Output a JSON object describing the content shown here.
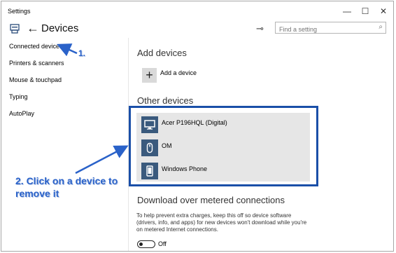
{
  "window": {
    "title": "Settings",
    "minimize": "—",
    "maximize": "☐",
    "close": "✕"
  },
  "header": {
    "back_glyph": "←",
    "title": "Devices",
    "pin_glyph": "⊸",
    "search_placeholder": "Find a setting",
    "search_glyph": "⌕"
  },
  "sidebar": {
    "items": [
      {
        "label": "Connected devices",
        "selected": true
      },
      {
        "label": "Printers & scanners"
      },
      {
        "label": "Mouse & touchpad"
      },
      {
        "label": "Typing"
      },
      {
        "label": "AutoPlay"
      }
    ]
  },
  "content": {
    "add_heading": "Add devices",
    "add_button_glyph": "+",
    "add_label": "Add a device",
    "other_heading": "Other devices",
    "devices": [
      {
        "name": "Acer P196HQL (Digital)",
        "icon": "monitor-icon"
      },
      {
        "name": "OM",
        "icon": "mouse-icon"
      },
      {
        "name": "Windows Phone",
        "icon": "phone-icon"
      }
    ],
    "metered_heading": "Download over metered connections",
    "metered_desc": "To help prevent extra charges, keep this off so device software (drivers, info, and apps) for new devices won't download while you're on metered Internet connections.",
    "toggle_label": "Off",
    "toggle_on": false
  },
  "annotations": {
    "step1": "1.",
    "step2_line1": "2. Click on a device to",
    "step2_line2": "remove it"
  },
  "colors": {
    "accent": "#2a62c9",
    "highlight_border": "#1a4fa8",
    "device_icon_bg": "#3a5a7d",
    "panel_bg": "#e6e6e6"
  }
}
